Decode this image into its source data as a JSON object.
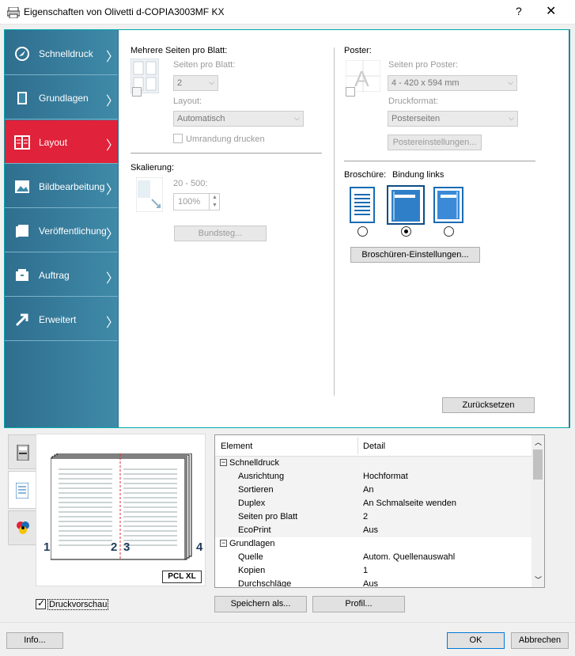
{
  "window": {
    "title": "Eigenschaften von Olivetti d-COPIA3003MF KX",
    "help": "?",
    "close": "✕"
  },
  "sidebar": {
    "items": [
      {
        "label": "Schnelldruck",
        "icon": "rocket-icon"
      },
      {
        "label": "Grundlagen",
        "icon": "page-icon"
      },
      {
        "label": "Layout",
        "icon": "layout-icon"
      },
      {
        "label": "Bildbearbeitung",
        "icon": "image-icon"
      },
      {
        "label": "Veröffentlichung",
        "icon": "publish-icon"
      },
      {
        "label": "Auftrag",
        "icon": "job-icon"
      },
      {
        "label": "Erweitert",
        "icon": "advanced-icon"
      }
    ],
    "active": "Layout"
  },
  "layout": {
    "multi_pages": {
      "heading": "Mehrere Seiten pro Blatt:",
      "pages_label": "Seiten pro Blatt:",
      "pages_value": "2",
      "layout_label": "Layout:",
      "layout_value": "Automatisch",
      "border_label": "Umrandung drucken"
    },
    "scaling": {
      "heading": "Skalierung:",
      "range": "20 - 500:",
      "value": "100%",
      "gutter_button": "Bundsteg..."
    },
    "poster": {
      "heading": "Poster:",
      "pages_label": "Seiten pro Poster:",
      "pages_value": "4 - 420 x 594 mm",
      "format_label": "Druckformat:",
      "format_value": "Posterseiten",
      "settings_button": "Postereinstellungen..."
    },
    "brochure": {
      "heading": "Broschüre:",
      "binding": "Bindung links",
      "settings_button": "Broschüren-Einstellungen..."
    },
    "reset_button": "Zurücksetzen"
  },
  "preview": {
    "page_numbers": [
      "1",
      "2",
      "3",
      "4"
    ],
    "pcl_badge": "PCL XL",
    "checkbox_label": "Druckvorschau"
  },
  "summary": {
    "col_element": "Element",
    "col_detail": "Detail",
    "rows": [
      {
        "type": "group",
        "element": "Schnelldruck",
        "detail": ""
      },
      {
        "type": "item",
        "element": "Ausrichtung",
        "detail": "Hochformat"
      },
      {
        "type": "item",
        "element": "Sortieren",
        "detail": "An"
      },
      {
        "type": "item",
        "element": "Duplex",
        "detail": "An Schmalseite wenden"
      },
      {
        "type": "item",
        "element": "Seiten pro Blatt",
        "detail": "2"
      },
      {
        "type": "item",
        "element": "EcoPrint",
        "detail": "Aus"
      },
      {
        "type": "group",
        "element": "Grundlagen",
        "detail": ""
      },
      {
        "type": "item",
        "element": "Quelle",
        "detail": "Autom. Quellenauswahl"
      },
      {
        "type": "item",
        "element": "Kopien",
        "detail": "1"
      },
      {
        "type": "item",
        "element": "Durchschläge",
        "detail": "Aus"
      }
    ]
  },
  "buttons": {
    "save_as": "Speichern als...",
    "profile": "Profil...",
    "info": "Info...",
    "ok": "OK",
    "cancel": "Abbrechen"
  },
  "colors": {
    "active_tab": "#e0223a",
    "sidebar": "#2f6e8f",
    "accent": "#0078d7"
  }
}
